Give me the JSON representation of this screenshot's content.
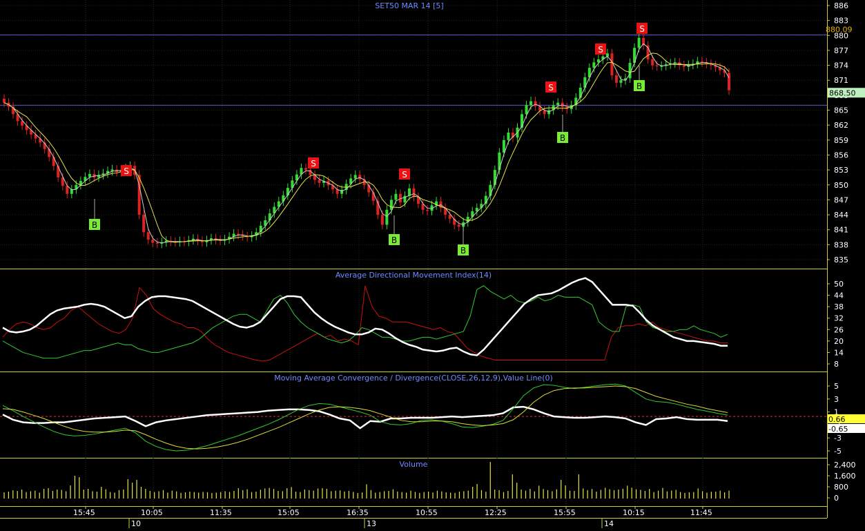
{
  "chart_data": {
    "type": "candlestick",
    "title": "SET50 MAR 14   [5]",
    "panels": [
      {
        "name": "price",
        "title": "SET50 MAR 14   [5]",
        "ylim": [
          833,
          888
        ],
        "yticks": [
          886,
          883,
          880,
          877,
          874,
          871,
          868,
          865,
          862,
          859,
          856,
          853,
          850,
          847,
          844,
          841,
          838,
          835
        ],
        "hlines": [
          880.09,
          866.0
        ],
        "last_price_label": "868.50",
        "level_label": "880.09",
        "close": [
          866.5,
          865.7,
          864.2,
          862.8,
          861.9,
          861.0,
          860.1,
          859.3,
          858.5,
          857.2,
          855.6,
          853.8,
          851.5,
          849.8,
          848.2,
          849.1,
          850.0,
          850.8,
          851.6,
          852.2,
          851.5,
          852.0,
          852.3,
          852.8,
          853.1,
          852.6,
          853.0,
          853.3,
          853.8,
          852.0,
          844.0,
          840.5,
          839.0,
          838.4,
          838.2,
          838.5,
          838.8,
          838.6,
          838.5,
          838.7,
          838.6,
          838.9,
          839.2,
          838.8,
          838.5,
          838.9,
          839.3,
          839.0,
          838.8,
          839.1,
          839.6,
          840.2,
          840.0,
          839.7,
          839.5,
          839.8,
          840.5,
          841.8,
          842.9,
          844.3,
          845.6,
          846.7,
          847.9,
          849.4,
          850.9,
          852.1,
          853.4,
          853.0,
          852.0,
          851.0,
          850.4,
          850.8,
          849.9,
          849.1,
          848.2,
          849.0,
          850.2,
          851.3,
          852.0,
          851.1,
          850.0,
          848.5,
          846.8,
          844.0,
          842.0,
          845.0,
          847.0,
          848.2,
          846.5,
          847.8,
          849.3,
          847.6,
          846.2,
          845.0,
          844.8,
          845.9,
          846.7,
          845.4,
          844.0,
          843.2,
          842.0,
          841.6,
          842.5,
          843.6,
          844.7,
          845.4,
          846.2,
          847.8,
          850.0,
          853.0,
          856.5,
          859.0,
          860.5,
          859.5,
          861.5,
          864.2,
          866.0,
          866.8,
          865.8,
          864.9,
          864.2,
          865.0,
          866.0,
          866.5,
          865.6,
          865.2,
          866.0,
          867.5,
          869.5,
          871.6,
          873.5,
          874.6,
          875.2,
          875.8,
          876.4,
          872.0,
          870.5,
          871.0,
          871.4,
          874.5,
          877.5,
          879.5,
          878.0,
          875.2,
          874.0,
          873.8,
          873.9,
          874.2,
          874.4,
          874.6,
          874.0,
          873.7,
          874.1,
          874.3,
          874.8,
          874.6,
          874.3,
          874.0,
          873.6,
          873.0,
          872.5,
          869.0
        ],
        "buy_signals": [
          "15:25",
          "10:55",
          "11:20",
          "16:05",
          "14:52",
          "10:40"
        ],
        "sell_signals": [
          "10:00",
          "15:30",
          "15:05",
          "12:40",
          "13:30",
          "14:10"
        ]
      },
      {
        "name": "adx",
        "title": "Average Directional Movement Index(14)",
        "ylim": [
          4,
          54
        ],
        "yticks": [
          50,
          44,
          38,
          32,
          26,
          20,
          14,
          8
        ],
        "series": [
          {
            "name": "ADX",
            "color": "#ffffff",
            "values": [
              27,
              25,
              24.5,
              25,
              26,
              28,
              31,
              34,
              36,
              37,
              37.5,
              38,
              39,
              39.5,
              39,
              38,
              36,
              34,
              32,
              33,
              38,
              41,
              43,
              43.5,
              43.5,
              43,
              42.5,
              42,
              41,
              39,
              37,
              35,
              33,
              31,
              29,
              27.5,
              27,
              28,
              30,
              34,
              38,
              42,
              43.5,
              43.5,
              43,
              39,
              35,
              32,
              29.5,
              27.5,
              26,
              24.5,
              23.5,
              23.5,
              24.5,
              26.5,
              26,
              24,
              21.5,
              19.5,
              18,
              17,
              15.5,
              15,
              14.5,
              15,
              16,
              16.5,
              14.5,
              13,
              12.5,
              15.5,
              19.5,
              23.5,
              27.5,
              31.5,
              35.5,
              39.5,
              42,
              44,
              44.5,
              45,
              46.5,
              48.5,
              50.5,
              52,
              53,
              51,
              47,
              43,
              39,
              39,
              39,
              38.5,
              35,
              31,
              28,
              26,
              24,
              22,
              21,
              20,
              20,
              19.5,
              19,
              18.5,
              17.5,
              17.5
            ]
          },
          {
            "name": "+DI",
            "color": "#33cc33",
            "values": [
              20,
              18,
              16,
              14,
              13,
              12,
              11,
              11,
              11,
              12,
              13,
              14,
              15,
              15,
              16,
              17,
              18,
              19,
              18,
              18,
              16,
              15,
              14,
              14,
              15,
              16,
              17,
              18,
              19,
              21,
              24,
              27,
              29,
              31,
              33,
              34,
              34,
              32,
              30,
              36,
              42,
              44,
              40,
              34,
              30,
              27,
              25,
              23,
              21,
              20,
              19,
              20,
              23,
              27,
              26,
              24,
              22,
              22,
              21,
              20,
              20,
              21,
              22,
              22,
              21,
              22,
              23,
              24,
              25,
              33,
              47,
              49,
              46,
              44,
              42,
              44,
              41,
              40,
              41,
              43,
              41,
              42,
              44,
              43,
              43,
              43,
              41,
              39,
              30,
              27,
              25,
              25,
              38,
              39,
              38,
              30,
              27,
              26,
              25,
              25,
              26,
              26,
              28,
              26,
              25,
              24,
              22,
              23.5
            ]
          },
          {
            "name": "-DI",
            "color": "#cc1111",
            "values": [
              22,
              26,
              29,
              30,
              29,
              27,
              26,
              27,
              30,
              32,
              36,
              38,
              35,
              32,
              29,
              27,
              25,
              24,
              26,
              32,
              48,
              44,
              37,
              34,
              32,
              30,
              29,
              27,
              27,
              25,
              21,
              18,
              16,
              14,
              13,
              12,
              11,
              10,
              9.5,
              10,
              12,
              14,
              16,
              18,
              20,
              22,
              24,
              22,
              23,
              20,
              21,
              20,
              18,
              49,
              38,
              33,
              32,
              30,
              30,
              30,
              29,
              28,
              27,
              26,
              27,
              25,
              24,
              20,
              16,
              14,
              12,
              11,
              10,
              10,
              10,
              10,
              10,
              10,
              10,
              10,
              10,
              10,
              10,
              10,
              10,
              10,
              10,
              10,
              10,
              22,
              27,
              28,
              28,
              29,
              28,
              30,
              27,
              26,
              25,
              24,
              23,
              22,
              21,
              20,
              20,
              19,
              19
            ]
          }
        ]
      },
      {
        "name": "macd",
        "title": "Moving Average Convergence / Divergence(CLOSE,26,12,9),Value Line(0)",
        "ylim": [
          -6,
          7
        ],
        "yticks": [
          5,
          3,
          1,
          -1,
          -3,
          -5
        ],
        "value_labels": [
          "0.66",
          "-0.65"
        ],
        "series": [
          {
            "name": "MACD",
            "color": "#33cc33",
            "values": [
              2,
              1.2,
              0.3,
              -0.5,
              -1.3,
              -2,
              -2.5,
              -2.7,
              -2.6,
              -2.4,
              -2.1,
              -1.8,
              -1.5,
              -2.2,
              -3.5,
              -4.3,
              -4.8,
              -5,
              -4.9,
              -4.6,
              -4.2,
              -3.7,
              -3.2,
              -2.7,
              -2.1,
              -1.5,
              -0.9,
              -0.2,
              0.6,
              1.4,
              2,
              2.3,
              2.2,
              1.8,
              1.4,
              1,
              0.5,
              -0.5,
              -0.9,
              -1,
              -0.8,
              -0.3,
              -0.2,
              -0.4,
              -0.8,
              -1.3,
              -1.4,
              -1.2,
              -0.9,
              -0.3,
              1.5,
              3.5,
              4.7,
              5.2,
              5.1,
              4.8,
              4.6,
              4.8,
              5,
              5.2,
              5.3,
              5,
              4,
              3,
              2.6,
              2.5,
              2.2,
              1.8,
              1.4,
              1.1,
              0.8,
              0.5
            ]
          },
          {
            "name": "Signal",
            "color": "#dddd33",
            "values": [
              1.5,
              1.4,
              1,
              0.5,
              0,
              -0.6,
              -1.2,
              -1.7,
              -2,
              -2.1,
              -2.1,
              -2,
              -1.8,
              -1.9,
              -2.5,
              -3.2,
              -3.8,
              -4.3,
              -4.6,
              -4.7,
              -4.6,
              -4.4,
              -4.1,
              -3.7,
              -3.2,
              -2.6,
              -2,
              -1.4,
              -0.7,
              0,
              0.7,
              1.3,
              1.7,
              1.8,
              1.7,
              1.5,
              1.2,
              0.7,
              0.2,
              -0.3,
              -0.5,
              -0.5,
              -0.4,
              -0.4,
              -0.5,
              -0.8,
              -1,
              -1.1,
              -1,
              -0.8,
              -0.2,
              1,
              2.5,
              3.6,
              4.3,
              4.6,
              4.7,
              4.7,
              4.8,
              4.9,
              5,
              4.9,
              4.6,
              4,
              3.4,
              3,
              2.6,
              2.2,
              1.9,
              1.5,
              1.2,
              0.9
            ]
          },
          {
            "name": "Histogram",
            "color": "#ffffff",
            "values": [
              0.6,
              -0.2,
              -0.6,
              -0.7,
              -0.7,
              -0.6,
              -0.6,
              -0.4,
              -0.2,
              0,
              0.1,
              0.2,
              0.3,
              -0.4,
              -1.2,
              -0.6,
              -0.3,
              -0.1,
              0.1,
              0.3,
              0.5,
              0.6,
              0.7,
              0.8,
              0.9,
              1,
              1.2,
              1.3,
              1.4,
              1.4,
              1.3,
              1.1,
              0.6,
              0,
              -0.3,
              -1.5,
              -0.4,
              -0.5,
              0,
              0,
              0.1,
              0.1,
              0.1,
              0.2,
              0.3,
              0.2,
              0.3,
              0.4,
              0.5,
              0.8,
              1.7,
              1.8,
              1.4,
              0.8,
              0.3,
              0.2,
              0.1,
              0.1,
              0.2,
              0.3,
              0.2,
              0,
              -0.6,
              -1,
              -0.1,
              0,
              0.2,
              -0.1,
              -0.2,
              -0.2,
              -0.2,
              -0.4
            ]
          }
        ]
      },
      {
        "name": "volume",
        "title": "Volume",
        "ylim": [
          0,
          3200
        ],
        "yticks": [
          "2,400",
          "1,600",
          "800",
          "0"
        ],
        "values": [
          400,
          450,
          550,
          500,
          600,
          420,
          480,
          520,
          380,
          650,
          700,
          500,
          600,
          580,
          480,
          900,
          1600,
          1500,
          600,
          650,
          480,
          450,
          800,
          620,
          420,
          380,
          560,
          610,
          1350,
          1100,
          1300,
          800,
          650,
          500,
          420,
          480,
          560,
          380,
          520,
          470,
          360,
          400,
          450,
          420,
          380,
          430,
          410,
          350,
          380,
          420,
          480,
          430,
          500,
          700,
          560,
          620,
          420,
          450,
          590,
          680,
          720,
          640,
          500,
          480,
          700,
          780,
          450,
          420,
          600,
          560,
          520,
          680,
          700,
          650,
          480,
          520,
          540,
          460,
          500,
          430,
          350,
          390,
          980,
          560,
          380,
          420,
          480,
          500,
          620,
          460,
          420,
          380,
          520,
          430,
          360,
          420,
          450,
          390,
          520,
          470,
          400,
          380,
          360,
          450,
          480,
          520,
          800,
          1000,
          560,
          440,
          2600,
          600,
          560,
          420,
          500,
          1700,
          1100,
          600,
          520,
          650,
          470,
          880,
          640,
          560,
          480,
          620,
          1300,
          900,
          520,
          500,
          1700,
          680,
          560,
          640,
          450,
          580,
          730,
          620,
          560,
          600,
          660,
          880,
          740,
          620,
          580,
          500,
          640,
          420,
          520,
          720,
          470,
          530,
          580,
          420,
          360,
          400,
          420,
          680,
          480,
          380,
          440,
          450,
          520,
          400,
          520
        ]
      }
    ],
    "x_ticks": [
      "15:45",
      "10:05",
      "11:35",
      "15:05",
      "16:35",
      "10:55",
      "12:25",
      "15:55",
      "10:15",
      "11:45"
    ],
    "day_labels": [
      "10",
      "13",
      "14"
    ]
  }
}
